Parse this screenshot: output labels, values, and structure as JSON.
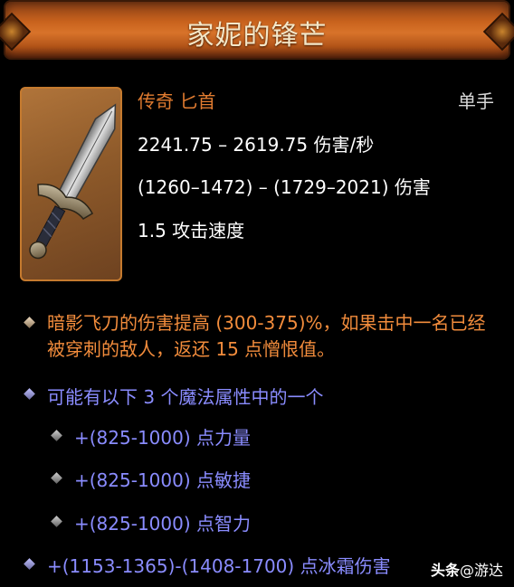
{
  "item": {
    "name": "家妮的锋芒",
    "type": "传奇 匕首",
    "slot": "单手",
    "dps": "2241.75 – 2619.75 伤害/秒",
    "damage": "(1260–1472) – (1729–2021) 伤害",
    "attack_speed": "1.5 攻击速度",
    "legendary_power": "暗影飞刀的伤害提高 (300-375)%，如果击中一名已经被穿刺的敌人，返还 15 点憎恨值。",
    "random_affix_header": "可能有以下 3 个魔法属性中的一个",
    "random_affixes": [
      "+(825-1000) 点力量",
      "+(825-1000) 点敏捷",
      "+(825-1000) 点智力"
    ],
    "cold_damage": "+(1153-1365)-(1408-1700) 点冰霜伤害"
  },
  "watermark": {
    "brand": "头条",
    "handle": "@游达"
  },
  "colors": {
    "legendary_orange": "#e07b30",
    "power_orange": "#f28c3c",
    "magic_blue": "#8a8cff",
    "header_orange": "#c8621d"
  },
  "icons": {
    "item_icon": "dagger-icon",
    "bullet": "diamond-bullet-icon"
  }
}
